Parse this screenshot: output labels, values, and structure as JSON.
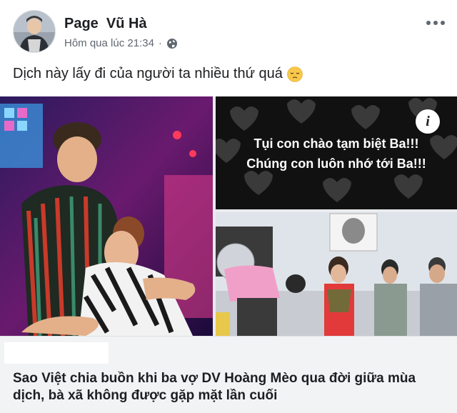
{
  "header": {
    "page_name": "Page  Vũ Hà",
    "timestamp": "Hôm qua lúc 21:34",
    "separator": "·",
    "privacy_icon": "globe-icon",
    "more_icon": "more-dots-icon"
  },
  "post": {
    "text": "Dịch này lấy đi của người ta nhiều thứ quá",
    "emoji": "pensive-face-emoji"
  },
  "media": {
    "caption_line1": "Tụi con chào tạm biệt Ba!!!",
    "caption_line2": "Chúng con luôn nhớ tới Ba!!!",
    "info_label": "i"
  },
  "link": {
    "title": "Sao Việt chia buồn khi ba vợ DV Hoàng Mèo qua đời giữa mùa dịch, bà xã không được gặp mặt lần cuối"
  },
  "colors": {
    "text_primary": "#1c1e21",
    "text_secondary": "#606770",
    "link_bg": "#f2f3f5"
  }
}
